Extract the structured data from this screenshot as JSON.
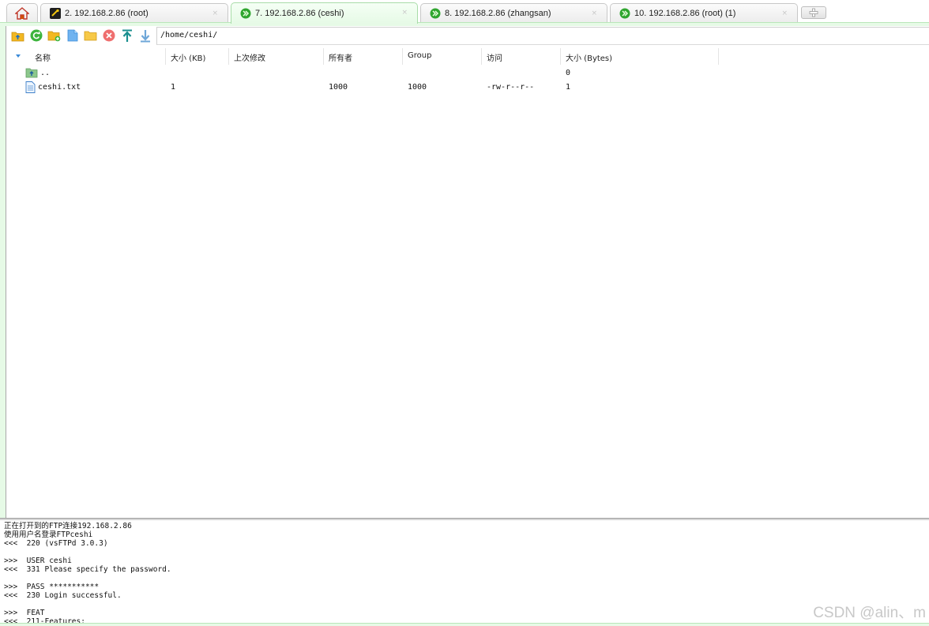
{
  "tabs": [
    {
      "label": "2. 192.168.2.86 (root)",
      "icon": "terminal-icon",
      "active": false
    },
    {
      "label": "7. 192.168.2.86 (ceshi)",
      "icon": "ftp-icon",
      "active": true
    },
    {
      "label": "8. 192.168.2.86 (zhangsan)",
      "icon": "ftp-icon",
      "active": false
    },
    {
      "label": "10. 192.168.2.86 (root) (1)",
      "icon": "ftp-icon",
      "active": false
    }
  ],
  "tab_close_glyph": "×",
  "path": "/home/ceshi/",
  "columns": [
    "名称",
    "大小 (KB)",
    "上次修改",
    "所有者",
    "Group",
    "访问",
    "大小 (Bytes)"
  ],
  "files": [
    {
      "name": "..",
      "size_kb": "",
      "modified": "",
      "owner": "",
      "group": "",
      "access": "",
      "size_bytes": "0",
      "type": "parent"
    },
    {
      "name": "ceshi.txt",
      "size_kb": "1",
      "modified": "",
      "owner": "1000",
      "group": "1000",
      "access": "-rw-r--r--",
      "size_bytes": "1",
      "type": "file"
    }
  ],
  "log": [
    "正在打开到的FTP连接192.168.2.86",
    "使用用户名登录FTPceshi",
    "<<<  220 (vsFTPd 3.0.3)",
    "",
    ">>>  USER ceshi",
    "<<<  331 Please specify the password.",
    "",
    ">>>  PASS ***********",
    "<<<  230 Login successful.",
    "",
    ">>>  FEAT",
    "<<<  211-Features:"
  ],
  "watermark": "CSDN @alin、m",
  "colors": {
    "accent_green": "#e6fae6",
    "ftp_icon": "#2fa52f",
    "sort_arrow": "#3a8ad8"
  }
}
